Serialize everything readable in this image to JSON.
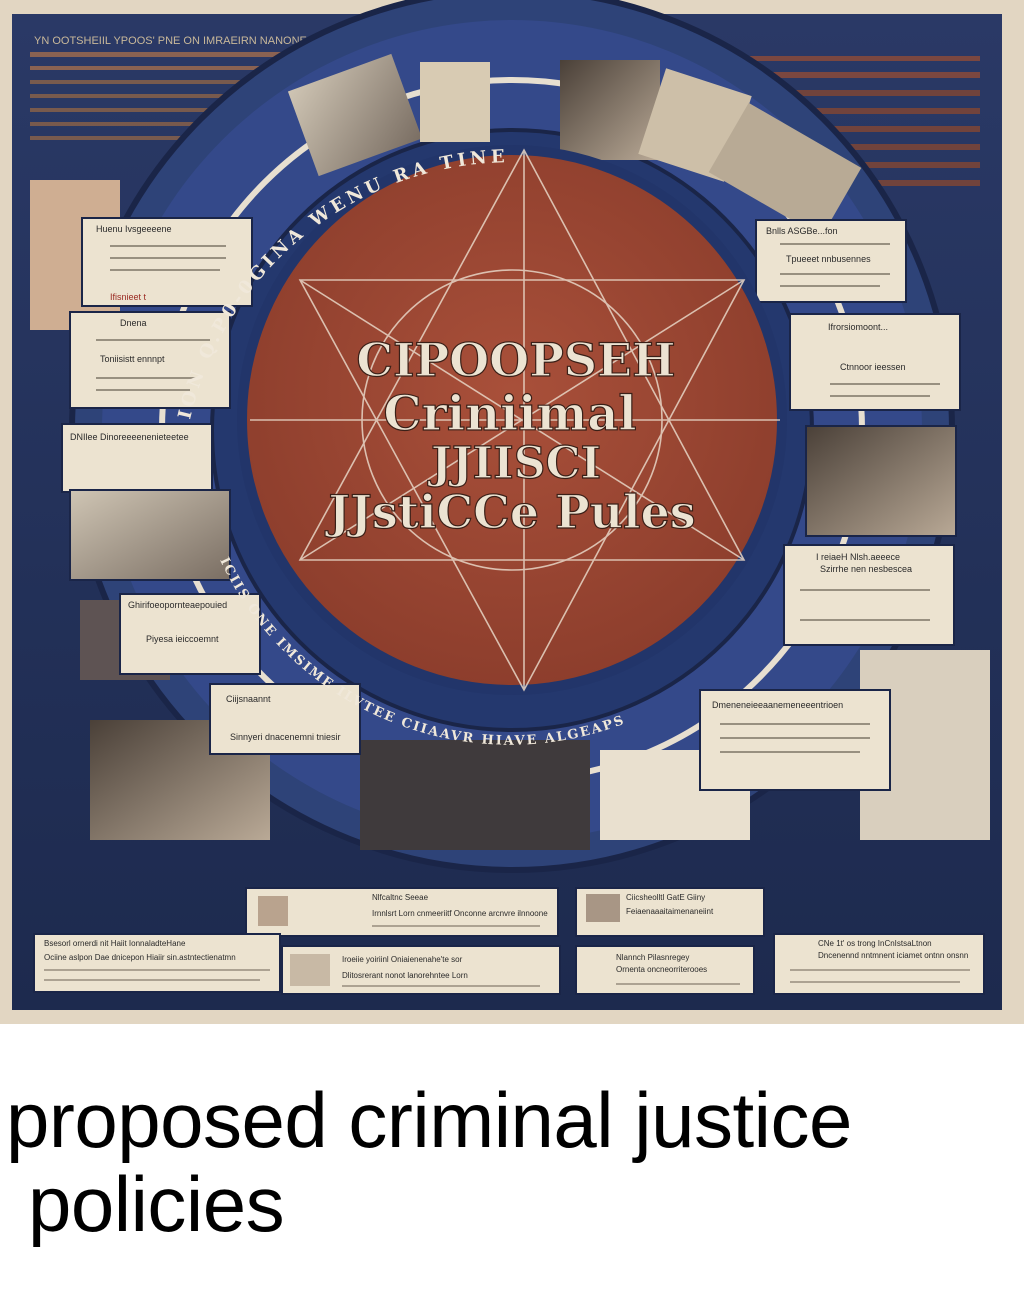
{
  "poster": {
    "top_banner": "YN OOTSHEIIL YPOOS' PNE ON IMRAEIRN NANONE V. I' FRSENTIN",
    "center_title": [
      "CIPOOPSEH",
      "Criniimal",
      "JJIISCI",
      "JJstiCCe Pules"
    ],
    "side_cards": [
      {
        "title": "Huenu Ivsgeeeene",
        "sub": "Ifisnieet t"
      },
      {
        "title": "Dnena",
        "sub": "Toniisistt ennnpt"
      },
      {
        "title": "DNIlee Dinoreeeenenieteetee",
        "sub": ""
      },
      {
        "title": "Ghirifoeopornteaepouied",
        "sub": "Piyesa ieiccoemnt"
      },
      {
        "title": "Ciijsnaannt",
        "sub": "Sinnyeri dnacenemni tniesir"
      },
      {
        "title": "Bnlls ASGBe...fon",
        "sub": "Tpueeet nnbusennes"
      },
      {
        "title": "Ifrorsiomoont...",
        "sub": "Ctnnoor ieessen"
      },
      {
        "title": "I reiaeH Nlsh.aeeece",
        "sub": "Szirrhe nen nesbescea"
      },
      {
        "title": "Dmeneneieeaanemeneeentrioen",
        "sub": ""
      }
    ],
    "ring_text_top": "ION Q.P0-0GINA WENU RA TINE",
    "ring_text_bottom": "ICIIS ONE IMSIME ILVTEE CIIAAVR HIAVE ALGEAPS",
    "bottom_panels": [
      {
        "title": "Nlfcaltnc Seeae",
        "body": "Irnnlsrt Lorn cnmeeriitf Onconne arcnvre ilnnoone"
      },
      {
        "title": "Ciicsheolltl GatE Giiny",
        "body": "Feiaenaaaitaimenaneiint"
      },
      {
        "title": "Bsesorl ornerdi nit Haiit IonnaladteHane",
        "body": "Ociine aslpon Dae dnicepon Hiaiir sin.astntectienatmn"
      },
      {
        "title": "Iroeiie yoiriinl Oniaienenahe'te sor",
        "body": "Dlitosrerant nonot lanorehntee Lorn"
      },
      {
        "title": "Nlannch Pilasnregey",
        "body": "Ornenta oncneorriterooes"
      },
      {
        "title": "CNe 1t' os trong InCnIstsaLtnon",
        "body": "Dncenennd nntmnent iciamet ontnn onsnn"
      }
    ],
    "colors": {
      "navy": "#23315c",
      "rust": "#9a4633",
      "paper": "#ece3d0",
      "ring_blue": "#3b5591"
    }
  },
  "caption": {
    "line1": "proposed criminal justice",
    "line2": "policies"
  }
}
